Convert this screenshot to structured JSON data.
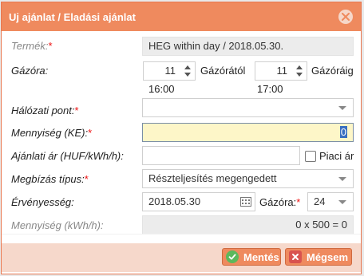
{
  "dialog": {
    "title": "Uj ajánlat / Eladási ajánlat",
    "close_icon": "close-icon"
  },
  "form": {
    "product": {
      "label": "Termék:",
      "required": "*",
      "value": "HEG within day / 2018.05.30."
    },
    "gas_hour": {
      "label": "Gázóra:",
      "from_value": "11",
      "from_label": "Gázórától",
      "from_time": "16:00",
      "to_value": "11",
      "to_label": "Gázóráig",
      "to_time": "17:00"
    },
    "network_point": {
      "label": "Hálózati pont:",
      "required": "*",
      "value": ""
    },
    "quantity_ke": {
      "label": "Mennyiség (KE):",
      "required": "*",
      "value": "0"
    },
    "offer_price": {
      "label": "Ajánlati ár (HUF/kWh/h):",
      "value": "",
      "market_price_label": "Piaci ár",
      "market_price_checked": false
    },
    "order_type": {
      "label": "Megbízás típus:",
      "required": "*",
      "value": "Részteljesítés megengedett"
    },
    "validity": {
      "label": "Érvényesség:",
      "date": "2018.05.30",
      "gas_hour_label": "Gázóra:",
      "required": "*",
      "gas_hour_value": "24"
    },
    "quantity_kwh": {
      "label": "Mennyiség (kWh/h):",
      "value": "0 x 500 = 0"
    }
  },
  "footer": {
    "save_label": "Mentés",
    "cancel_label": "Mégsem"
  },
  "colors": {
    "accent": "#ef8a5e",
    "save_icon": "#5cb85c",
    "cancel_icon": "#d9534f",
    "required": "#ee1111"
  }
}
